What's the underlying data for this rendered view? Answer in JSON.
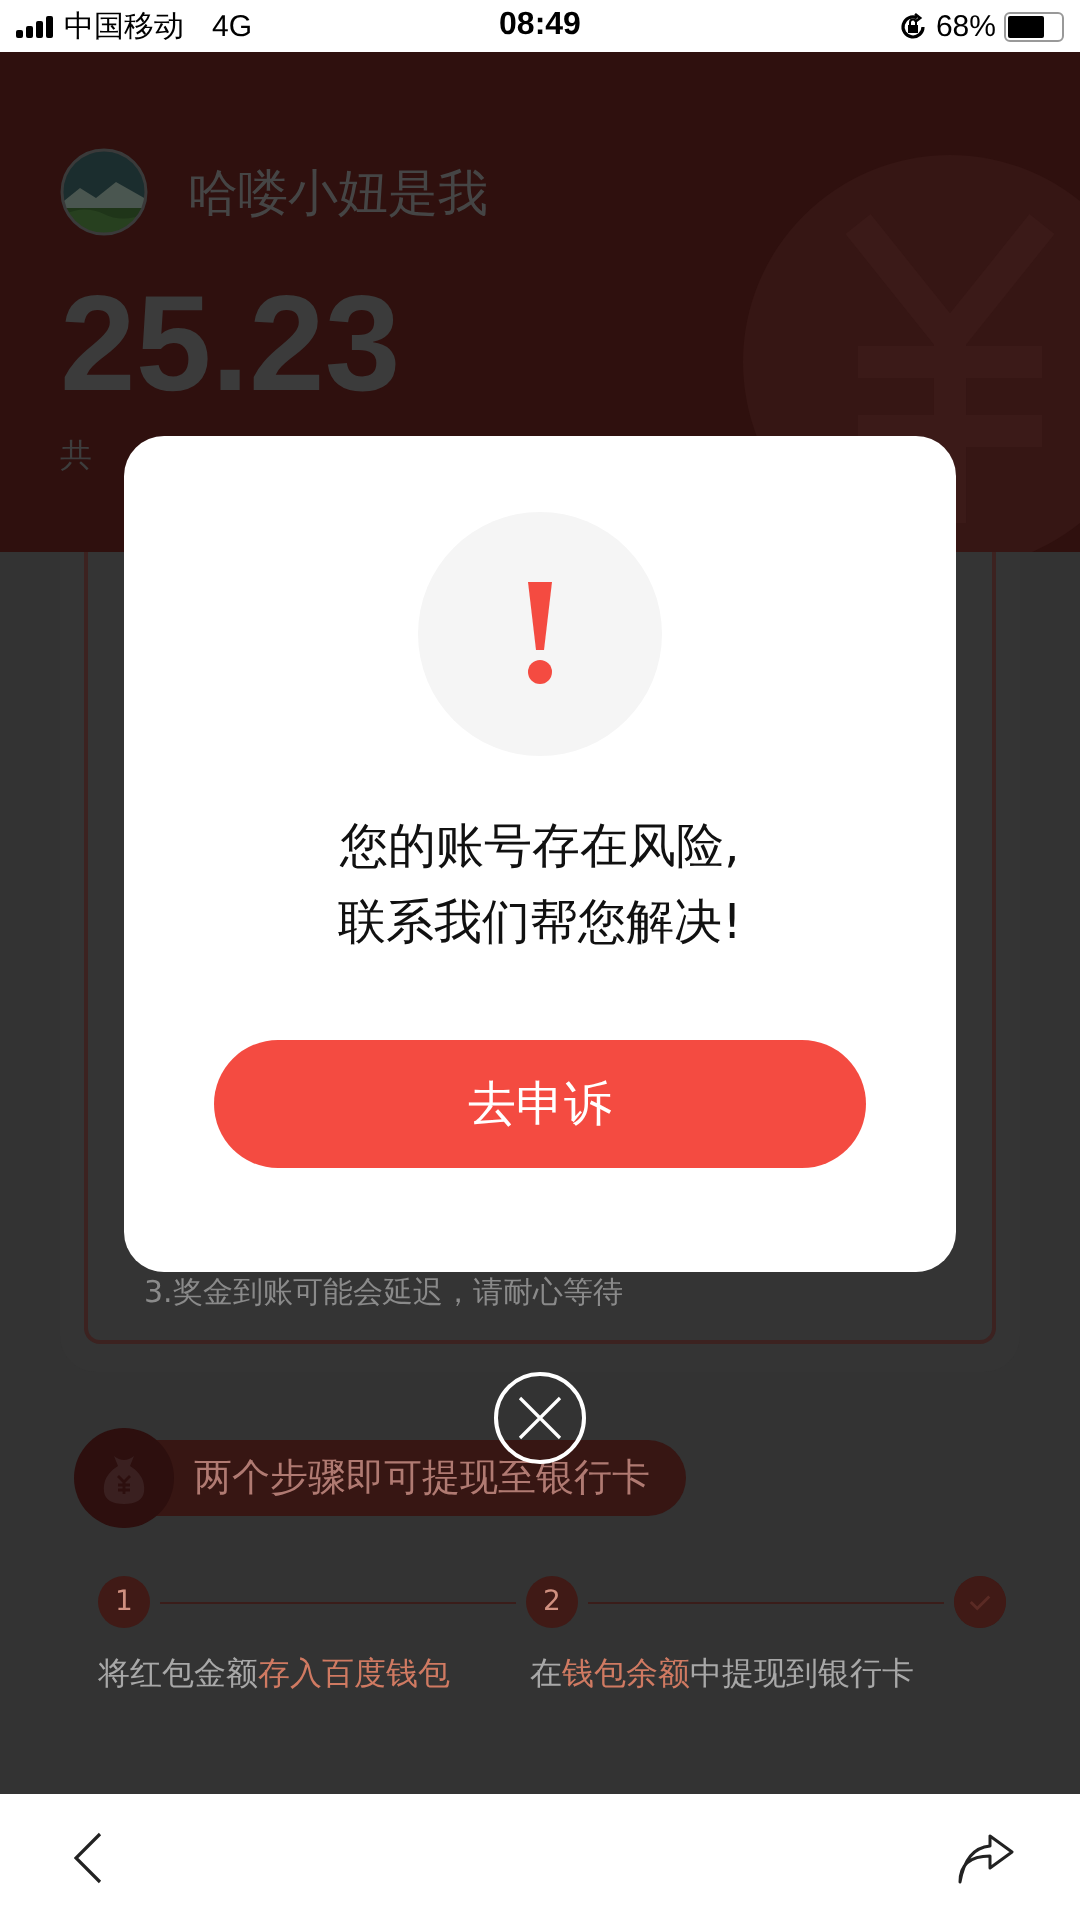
{
  "status_bar": {
    "carrier": "中国移动",
    "network": "4G",
    "time": "08:49",
    "battery": "68%"
  },
  "header": {
    "name": "哈喽小妞是我",
    "amount": "25.23",
    "caption": "共"
  },
  "card": {
    "note": "3.奖金到账可能会延迟，请耐心等待"
  },
  "steps": {
    "title": "两个步骤即可提现至银行卡",
    "items": [
      {
        "kind": "number",
        "label": "1",
        "parts": [
          {
            "text": "将红包金额",
            "highlight": false
          },
          {
            "text": "存入百度钱包",
            "highlight": true
          }
        ]
      },
      {
        "kind": "number",
        "label": "2",
        "parts": [
          {
            "text": "在",
            "highlight": false
          },
          {
            "text": "钱包余额",
            "highlight": true
          },
          {
            "text": "中提现到银行卡",
            "highlight": false
          }
        ]
      },
      {
        "kind": "done"
      }
    ]
  },
  "dialog": {
    "lines": [
      "您的账号存在风险,",
      "联系我们帮您解决!"
    ],
    "button": "去申诉"
  }
}
